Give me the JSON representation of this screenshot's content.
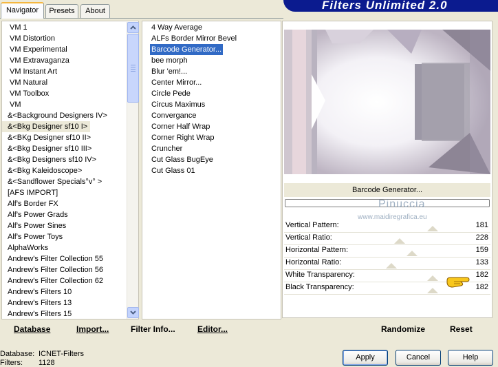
{
  "tabs": [
    {
      "label": "Navigator",
      "active": true
    },
    {
      "label": "Presets",
      "active": false
    },
    {
      "label": "About",
      "active": false
    }
  ],
  "banner": {
    "title": "Filters Unlimited 2.0"
  },
  "categories": [
    "VM 1",
    "VM Distortion",
    "VM Experimental",
    "VM Extravaganza",
    "VM Instant Art",
    "VM Natural",
    "VM Toolbox",
    "VM",
    "&<Background Designers IV>",
    "&<Bkg Designer sf10 I>",
    "&<BKg Designer sf10 II>",
    "&<Bkg Designer sf10 III>",
    "&<Bkg Designers sf10 IV>",
    "&<Bkg Kaleidoscope>",
    "&<Sandflower Specials°v° >",
    "[AFS IMPORT]",
    "Alf's Border FX",
    "Alf's Power Grads",
    "Alf's Power Sines",
    "Alf's Power Toys",
    "AlphaWorks",
    "Andrew's Filter Collection 55",
    "Andrew's Filter Collection 56",
    "Andrew's Filter Collection 62",
    "Andrew's Filters 10",
    "Andrew's Filters 13",
    "Andrew's Filters 15"
  ],
  "selected_category": "&<Bkg Designer sf10 I>",
  "filters": [
    "4 Way Average",
    "ALFs Border Mirror Bevel",
    "Barcode Generator...",
    "bee morph",
    "Blur 'em!...",
    "Center Mirror...",
    "Circle Pede",
    "Circus Maximus",
    "Convergance",
    "Corner Half Wrap",
    "Corner Right Wrap",
    "Cruncher",
    "Cut Glass  BugEye",
    "Cut Glass 01"
  ],
  "selected_filter": "Barcode Generator...",
  "preview_title": "Barcode Generator...",
  "watermark": {
    "name": "Pinuccia",
    "url": "www.maidiregrafica.eu"
  },
  "params": [
    {
      "label": "Vertical Pattern:",
      "value": "181"
    },
    {
      "label": "Vertical Ratio:",
      "value": "228"
    },
    {
      "label": "Horizontal Pattern:",
      "value": "159"
    },
    {
      "label": "Horizontal Ratio:",
      "value": "133"
    },
    {
      "label": "White Transparency:",
      "value": "182"
    },
    {
      "label": "Black Transparency:",
      "value": "182"
    }
  ],
  "bottom_links": {
    "database": "Database",
    "import": "Import...",
    "filter_info": "Filter Info...",
    "editor": "Editor..."
  },
  "right_links": {
    "randomize": "Randomize",
    "reset": "Reset"
  },
  "status": {
    "database_label": "Database:",
    "database_value": "ICNET-Filters",
    "filters_label": "Filters:",
    "filters_value": "1128"
  },
  "buttons": {
    "apply": "Apply",
    "cancel": "Cancel",
    "help": "Help"
  },
  "colors": {
    "selection": "#316ac5",
    "banner": "#0b1b8f",
    "tab_highlight": "#f5b73f"
  }
}
